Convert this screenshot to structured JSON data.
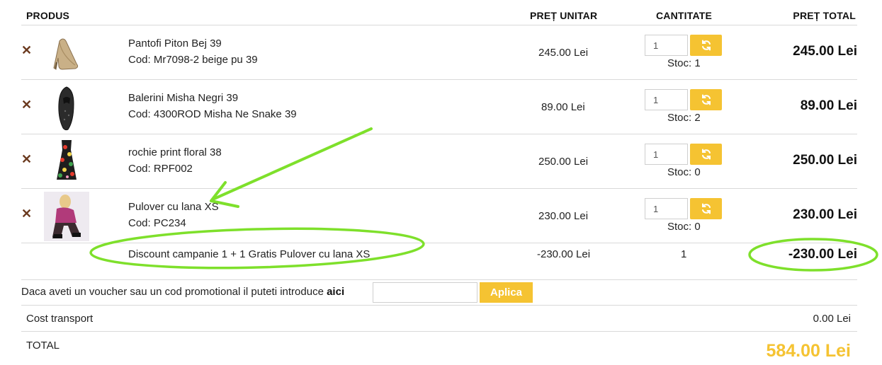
{
  "headers": {
    "product": "PRODUS",
    "unit_price": "PREȚ UNITAR",
    "quantity": "CANTITATE",
    "total_price": "PREȚ TOTAL"
  },
  "items": [
    {
      "name": "Pantofi Piton Bej 39",
      "code": "Cod: Mr7098-2 beige pu 39",
      "unit_price": "245.00 Lei",
      "qty": "1",
      "stock": "Stoc: 1",
      "total": "245.00 Lei",
      "thumb": "beige-pump-icon"
    },
    {
      "name": "Balerini Misha Negri 39",
      "code": "Cod: 4300ROD Misha Ne Snake 39",
      "unit_price": "89.00 Lei",
      "qty": "1",
      "stock": "Stoc: 2",
      "total": "89.00 Lei",
      "thumb": "black-flat-icon"
    },
    {
      "name": "rochie print floral 38",
      "code": "Cod: RPF002",
      "unit_price": "250.00 Lei",
      "qty": "1",
      "stock": "Stoc: 0",
      "total": "250.00 Lei",
      "thumb": "floral-dress-icon"
    },
    {
      "name": "Pulover cu lana XS",
      "code": "Cod: PC234",
      "unit_price": "230.00 Lei",
      "qty": "1",
      "stock": "Stoc: 0",
      "total": "230.00 Lei",
      "thumb": "sweater-model-icon"
    }
  ],
  "discount": {
    "label": "Discount campanie 1 + 1 Gratis Pulover cu lana XS",
    "unit_price": "-230.00 Lei",
    "qty": "1",
    "total": "-230.00 Lei"
  },
  "voucher": {
    "text": "Daca aveti un voucher sau un cod promotional il puteti introduce ",
    "link": "aici",
    "input_value": "",
    "button": "Aplica"
  },
  "transport": {
    "label": "Cost transport",
    "value": "0.00 Lei"
  },
  "grand_total": {
    "label": "TOTAL",
    "value": "584.00 Lei"
  },
  "colors": {
    "accent": "#f5c332",
    "annotation": "#7ee02b",
    "remove": "#6b3a1f"
  },
  "icons": {
    "remove": "close-icon",
    "refresh": "refresh-icon"
  }
}
